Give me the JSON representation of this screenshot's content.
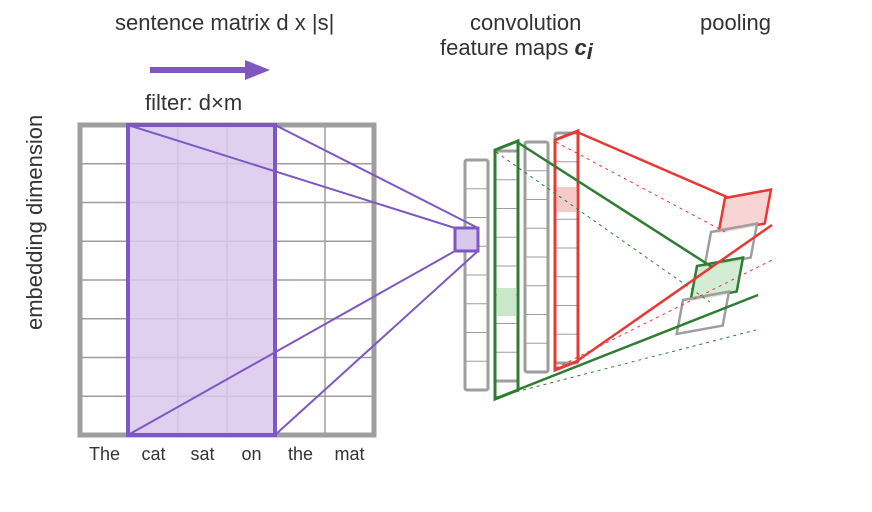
{
  "titles": {
    "matrix": "sentence matrix d x |s|",
    "conv_line1": "convolution",
    "conv_line2a": "feature maps ",
    "conv_line2b": "c",
    "conv_line2c": "i",
    "pooling": "pooling"
  },
  "filter_label": "filter: d×m",
  "y_axis_label": "embedding dimension",
  "words": [
    "The",
    "cat",
    "sat",
    "on",
    "the",
    "mat"
  ],
  "colors": {
    "grid": "#9E9E9E",
    "matrix_border": "#9E9E9E",
    "purple": "#7E57C2",
    "purple_fill": "#D8C8EB",
    "green": "#2E7D32",
    "green_fill": "#C9E7C9",
    "red": "#E53935",
    "red_fill": "#F8C9C9"
  },
  "chart_data": {
    "type": "diagram",
    "description": "1D CNN over a sentence matrix illustration",
    "sentence_matrix": {
      "rows_d": 8,
      "cols_s": 6,
      "tokens": [
        "The",
        "cat",
        "sat",
        "on",
        "the",
        "mat"
      ]
    },
    "filter": {
      "height_d": 8,
      "width_m": 3,
      "position_cols": [
        1,
        2,
        3
      ]
    },
    "feature_maps": {
      "count": 4,
      "length": 8
    },
    "convolution_output_cell_highlighted": {
      "map_index": 0,
      "row": 3
    },
    "pooling": {
      "type": "max",
      "output_per_map": 1,
      "displayed_maps": 4
    }
  }
}
